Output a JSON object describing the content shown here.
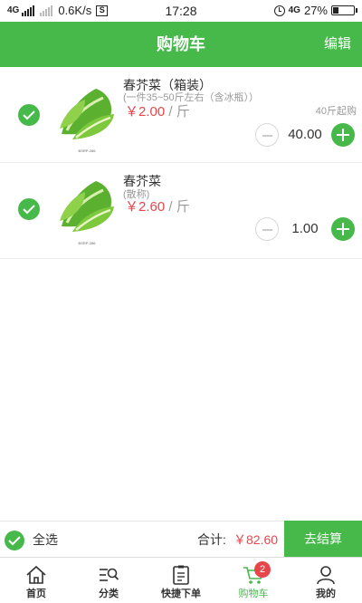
{
  "status_bar": {
    "network_type": "4G",
    "speed": "0.6K/s",
    "s_badge": "S",
    "time": "17:28",
    "network_type_2": "4G",
    "battery": "27%"
  },
  "header": {
    "title": "购物车",
    "edit": "编辑"
  },
  "cart": {
    "items": [
      {
        "name": "春芥菜（箱装）",
        "sub": "(一件35~50斤左右（含冰瓶））",
        "price": "￥2.00",
        "unit": " / 斤",
        "min_order": "40斤起购",
        "quantity": "40.00",
        "thumb_caption": "BSRP-286",
        "checked": true
      },
      {
        "name": "春芥菜",
        "sub": "(散称)",
        "price": "￥2.60",
        "unit": " / 斤",
        "min_order": "",
        "quantity": "1.00",
        "thumb_caption": "BSRP-286",
        "checked": true
      }
    ]
  },
  "checkout": {
    "select_all": "全选",
    "total_label": "合计:",
    "total_value": "￥82.60",
    "button": "去结算"
  },
  "tabbar": {
    "tabs": [
      {
        "label": "首页",
        "icon": "home-icon"
      },
      {
        "label": "分类",
        "icon": "category-icon"
      },
      {
        "label": "快捷下单",
        "icon": "quick-order-icon"
      },
      {
        "label": "购物车",
        "icon": "cart-icon",
        "badge": "2"
      },
      {
        "label": "我的",
        "icon": "user-icon"
      }
    ],
    "active": 3
  },
  "colors": {
    "brand": "#46b94a",
    "price": "#e8454b"
  }
}
